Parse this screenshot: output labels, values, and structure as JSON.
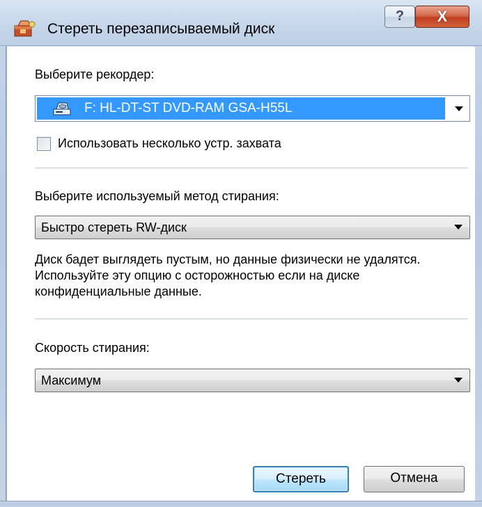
{
  "window": {
    "title": "Стереть перезаписываемый диск",
    "help_label": "?",
    "close_label": "X"
  },
  "recorder": {
    "label": "Выберите рекордер:",
    "selected": "F: HL-DT-ST DVD-RAM GSA-H55L",
    "multi_capture_label": "Использовать несколько устр. захвата",
    "multi_capture_checked": false
  },
  "method": {
    "label": "Выберите используемый метод стирания:",
    "selected": "Быстро стереть RW-диск",
    "description": "Диск бадет выглядеть пустым, но данные физически не удалятся. Используйте эту опцию с осторожностью если на диске конфиденциальные данные."
  },
  "speed": {
    "label": "Скорость стирания:",
    "selected": "Максимум"
  },
  "buttons": {
    "erase": "Стереть",
    "cancel": "Отмена"
  },
  "colors": {
    "selection": "#3399ff",
    "close_button": "#c84d2e",
    "default_button_border": "#3c7fb1"
  }
}
